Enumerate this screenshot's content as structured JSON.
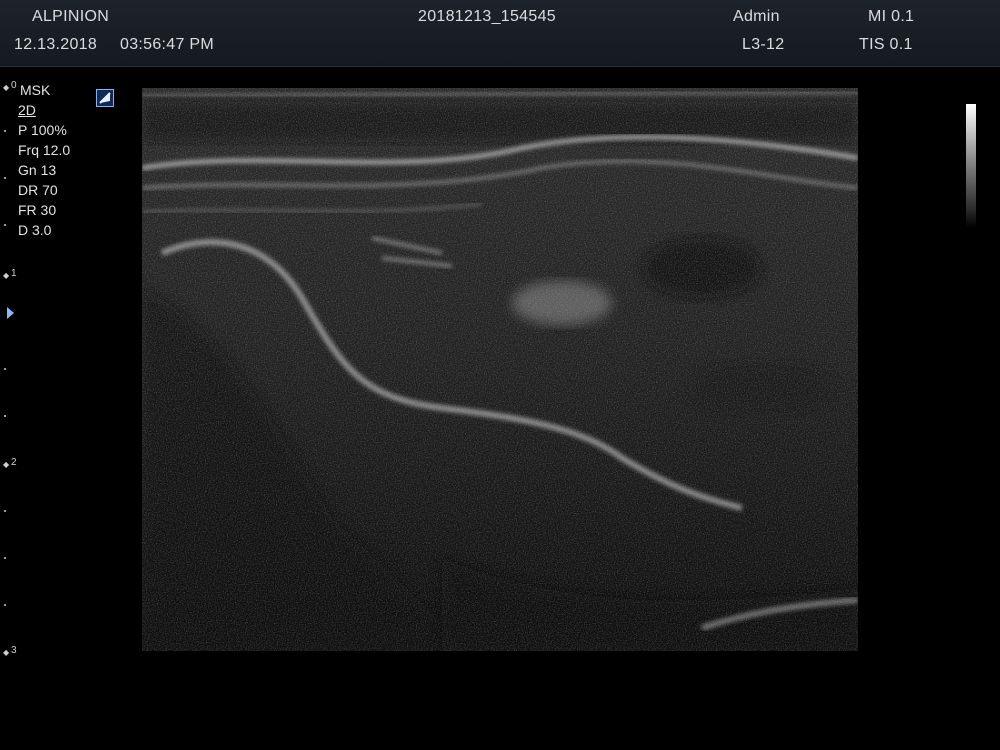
{
  "header": {
    "brand": "ALPINION",
    "date": "12.13.2018",
    "time": "03:56:47 PM",
    "file_id": "20181213_154545",
    "user": "Admin",
    "probe": "L3-12",
    "mi": "MI 0.1",
    "tis": "TIS 0.1"
  },
  "params": {
    "preset": "MSK",
    "mode": "2D",
    "power": "P 100%",
    "frequency": "Frq 12.0",
    "gain": "Gn 13",
    "dynamic_range": "DR 70",
    "frame_rate": "FR 30",
    "depth": "D 3.0"
  },
  "depth_scale": {
    "labels": [
      "0",
      "1",
      "2",
      "3"
    ]
  },
  "icons": {
    "orientation": "orientation-marker-icon",
    "focus": "focus-marker-icon"
  },
  "colors": {
    "header_bg": "#1a2027",
    "background": "#000000",
    "text": "#dcdcdc",
    "marker": "#8fb8ff"
  }
}
